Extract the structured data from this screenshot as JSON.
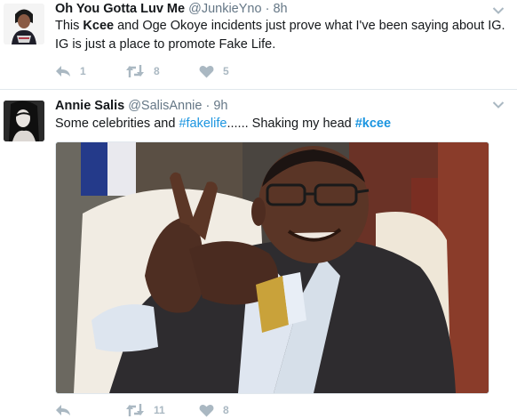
{
  "tweets": [
    {
      "name": "Oh You Gotta Luv Me",
      "handle": "@JunkieYno",
      "separator": "·",
      "time": "8h",
      "text": {
        "l1_a": "This ",
        "l1_b": "Kcee",
        "l1_c": " and Oge Okoye incidents just prove what I've been saying about IG.",
        "l2": "IG is just a place to promote Fake Life."
      },
      "actions": {
        "replies": "1",
        "retweets": "8",
        "likes": "5"
      }
    },
    {
      "name": "Annie Salis",
      "handle": "@SalisAnnie",
      "separator": "·",
      "time": "9h",
      "text": {
        "a": "Some celebrities and ",
        "hashtag1": "#fakelife",
        "b": "...... Shaking my head ",
        "hashtag2": "#kcee"
      },
      "actions": {
        "replies": "",
        "retweets": "11",
        "likes": "8"
      }
    }
  ],
  "icons": {
    "reply": "reply-icon",
    "retweet": "retweet-icon",
    "like": "heart-icon",
    "more": "chevron-down-icon"
  },
  "colors": {
    "text": "#14171a",
    "muted": "#657786",
    "action": "#aab8c2",
    "link": "#1b95e0",
    "divider": "#e1e8ed"
  }
}
